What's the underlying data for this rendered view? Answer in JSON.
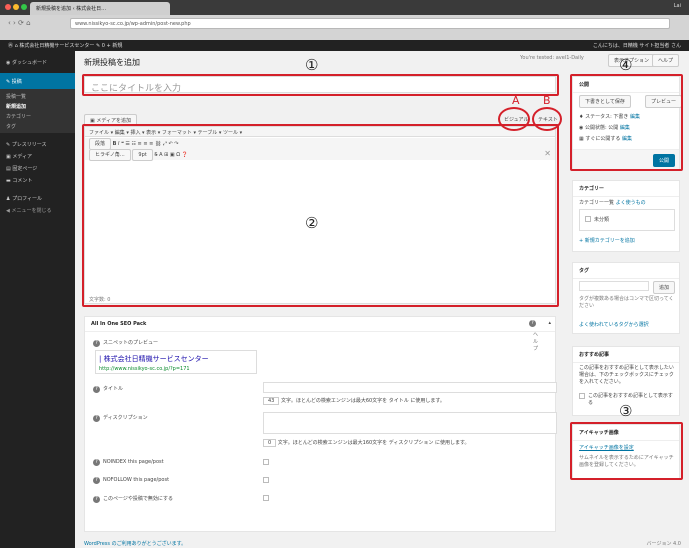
{
  "browser": {
    "tab_title": "新規投稿を追加 ‹ 株式会社日…",
    "user_label": "Lai",
    "url": "www.nissikyo-sc.co.jp/wp-admin/post-new.php"
  },
  "adminbar": {
    "site_name": "株式会社日精機サービスセンター",
    "comments": "0",
    "new_label": "新規",
    "greeting": "こんにちは、日精機 サイト担当者 さん"
  },
  "sidebar": {
    "dashboard": "ダッシュボード",
    "posts": "投稿",
    "posts_sub": [
      "投稿一覧",
      "新規追加",
      "カテゴリー",
      "タグ"
    ],
    "press": "プレスリリース",
    "media": "メディア",
    "pages": "固定ページ",
    "comments": "コメント",
    "profile": "プロフィール",
    "collapse": "メニューを閉じる"
  },
  "page": {
    "heading": "新規投稿を追加",
    "screen_options": "表示オプション",
    "help": "ヘルプ",
    "notice": "You're tested: avel1-Daily",
    "title_placeholder": "ここにタイトルを入力"
  },
  "editor": {
    "add_media": "メディアを追加",
    "visual_tab": "ビジュアル",
    "text_tab": "テキスト",
    "menu": [
      "ファイル",
      "編集",
      "挿入",
      "表示",
      "フォーマット",
      "テーブル",
      "ツール"
    ],
    "format_select": "段落",
    "font_select": "ヒラギノ角…",
    "size_select": "9pt",
    "word_count": "文字数: 0"
  },
  "seo": {
    "title": "All In One SEO Pack",
    "snippet_label": "スニペットのプレビュー",
    "snippet_title": "| 株式会社日精機サービスセンター",
    "snippet_url": "http://www.nissikyo-sc.co.jp/?p=171",
    "field_title": "タイトル",
    "title_count": "43",
    "title_hint": "文字。ほとんどの検索エンジンは最大60文字を タイトル に使用します。",
    "field_desc": "ディスクリプション",
    "desc_count": "0",
    "desc_hint": "文字。ほとんどの検索エンジンは最大160文字を ディスクリプション に使用します。",
    "noindex": "NOINDEX this page/post",
    "nofollow": "NOFOLLOW this page/post",
    "disable": "このページや投稿で無効にする",
    "help_text": "ヘルプ"
  },
  "publish": {
    "title": "公開",
    "save_draft": "下書きとして保存",
    "preview": "プレビュー",
    "status": "ステータス: 下書き",
    "visibility": "公開状態: 公開",
    "schedule": "すぐに公開する",
    "edit": "編集",
    "publish_btn": "公開"
  },
  "category": {
    "title": "カテゴリー",
    "tab_all": "カテゴリー一覧",
    "tab_popular": "よく使うもの",
    "item": "未分類",
    "add_new": "+ 新規カテゴリーを追加"
  },
  "tags": {
    "title": "タグ",
    "add_btn": "追加",
    "hint": "タグが複数ある場合はコンマで区切ってください",
    "choose": "よく使われているタグから選択"
  },
  "recommend": {
    "title": "おすすめ記事",
    "desc": "この記事をおすすめ記事として表示したい場合は、下のチェックボックスにチェックを入れてください。",
    "checkbox": "この記事をおすすめ記事として表示する"
  },
  "featured": {
    "title": "アイキャッチ画像",
    "set_link": "アイキャッチ画像を設定",
    "hint": "サムネイルを表示するためにアイキャッチ画像を登録してください。"
  },
  "footer": {
    "thanks": "WordPress のご利用ありがとうございます。",
    "version": "バージョン 4.0"
  },
  "annotations": {
    "n1": "①",
    "n2": "②",
    "n3": "③",
    "n4": "④",
    "a": "A",
    "b": "B"
  },
  "colors": {
    "accent": "#0074a2",
    "annotation": "#d4202a",
    "admin_bg": "#222222"
  }
}
